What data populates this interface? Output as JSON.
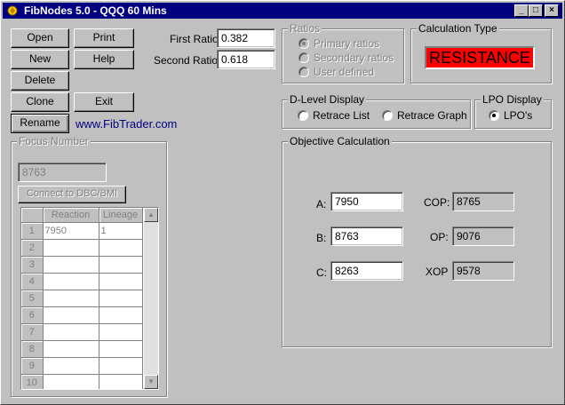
{
  "window": {
    "title": "FibNodes 5.0 - QQQ 60 Mins",
    "min_glyph": "_",
    "max_glyph": "□",
    "close_glyph": "×",
    "icon": "fibnodes-app-icon"
  },
  "buttons": {
    "open": "Open",
    "print": "Print",
    "new": "New",
    "help": "Help",
    "delete": "Delete",
    "clone": "Clone",
    "exit": "Exit",
    "rename": "Rename"
  },
  "website": "www.FibTrader.com",
  "ratios_inputs": {
    "first_label": "First Ratio",
    "first_value": "0.382",
    "second_label": "Second Ratio",
    "second_value": "0.618"
  },
  "ratios_group": {
    "title": "Ratios",
    "options": [
      "Primary ratios",
      "Secondary ratios",
      "User defined"
    ],
    "selected_index": 0
  },
  "calculation_type": {
    "title": "Calculation Type",
    "value": "RESISTANCE",
    "color": "#ff0000"
  },
  "dlevel_display": {
    "title": "D-Level Display",
    "options": [
      "Retrace List",
      "Retrace Graph"
    ],
    "selected_index": -1
  },
  "lpo_display": {
    "title": "LPO Display",
    "option": "LPO's",
    "selected": true
  },
  "objective": {
    "title": "Objective Calculation",
    "a_label": "A:",
    "a_value": "7950",
    "b_label": "B:",
    "b_value": "8763",
    "c_label": "C:",
    "c_value": "8263",
    "cop_label": "COP:",
    "cop_value": "8765",
    "op_label": "OP:",
    "op_value": "9076",
    "xop_label": "XOP",
    "xop_value": "9578"
  },
  "focus": {
    "title": "Focus Number",
    "value": "8763",
    "connect_button": "Connect to DBC/BMI",
    "columns": [
      "Reaction",
      "Lineage"
    ],
    "rows": [
      {
        "num": "1",
        "reaction": "7950",
        "lineage": "1"
      },
      {
        "num": "2",
        "reaction": "",
        "lineage": ""
      },
      {
        "num": "3",
        "reaction": "",
        "lineage": ""
      },
      {
        "num": "4",
        "reaction": "",
        "lineage": ""
      },
      {
        "num": "5",
        "reaction": "",
        "lineage": ""
      },
      {
        "num": "6",
        "reaction": "",
        "lineage": ""
      },
      {
        "num": "7",
        "reaction": "",
        "lineage": ""
      },
      {
        "num": "8",
        "reaction": "",
        "lineage": ""
      },
      {
        "num": "9",
        "reaction": "",
        "lineage": ""
      },
      {
        "num": "10",
        "reaction": "",
        "lineage": ""
      }
    ]
  }
}
